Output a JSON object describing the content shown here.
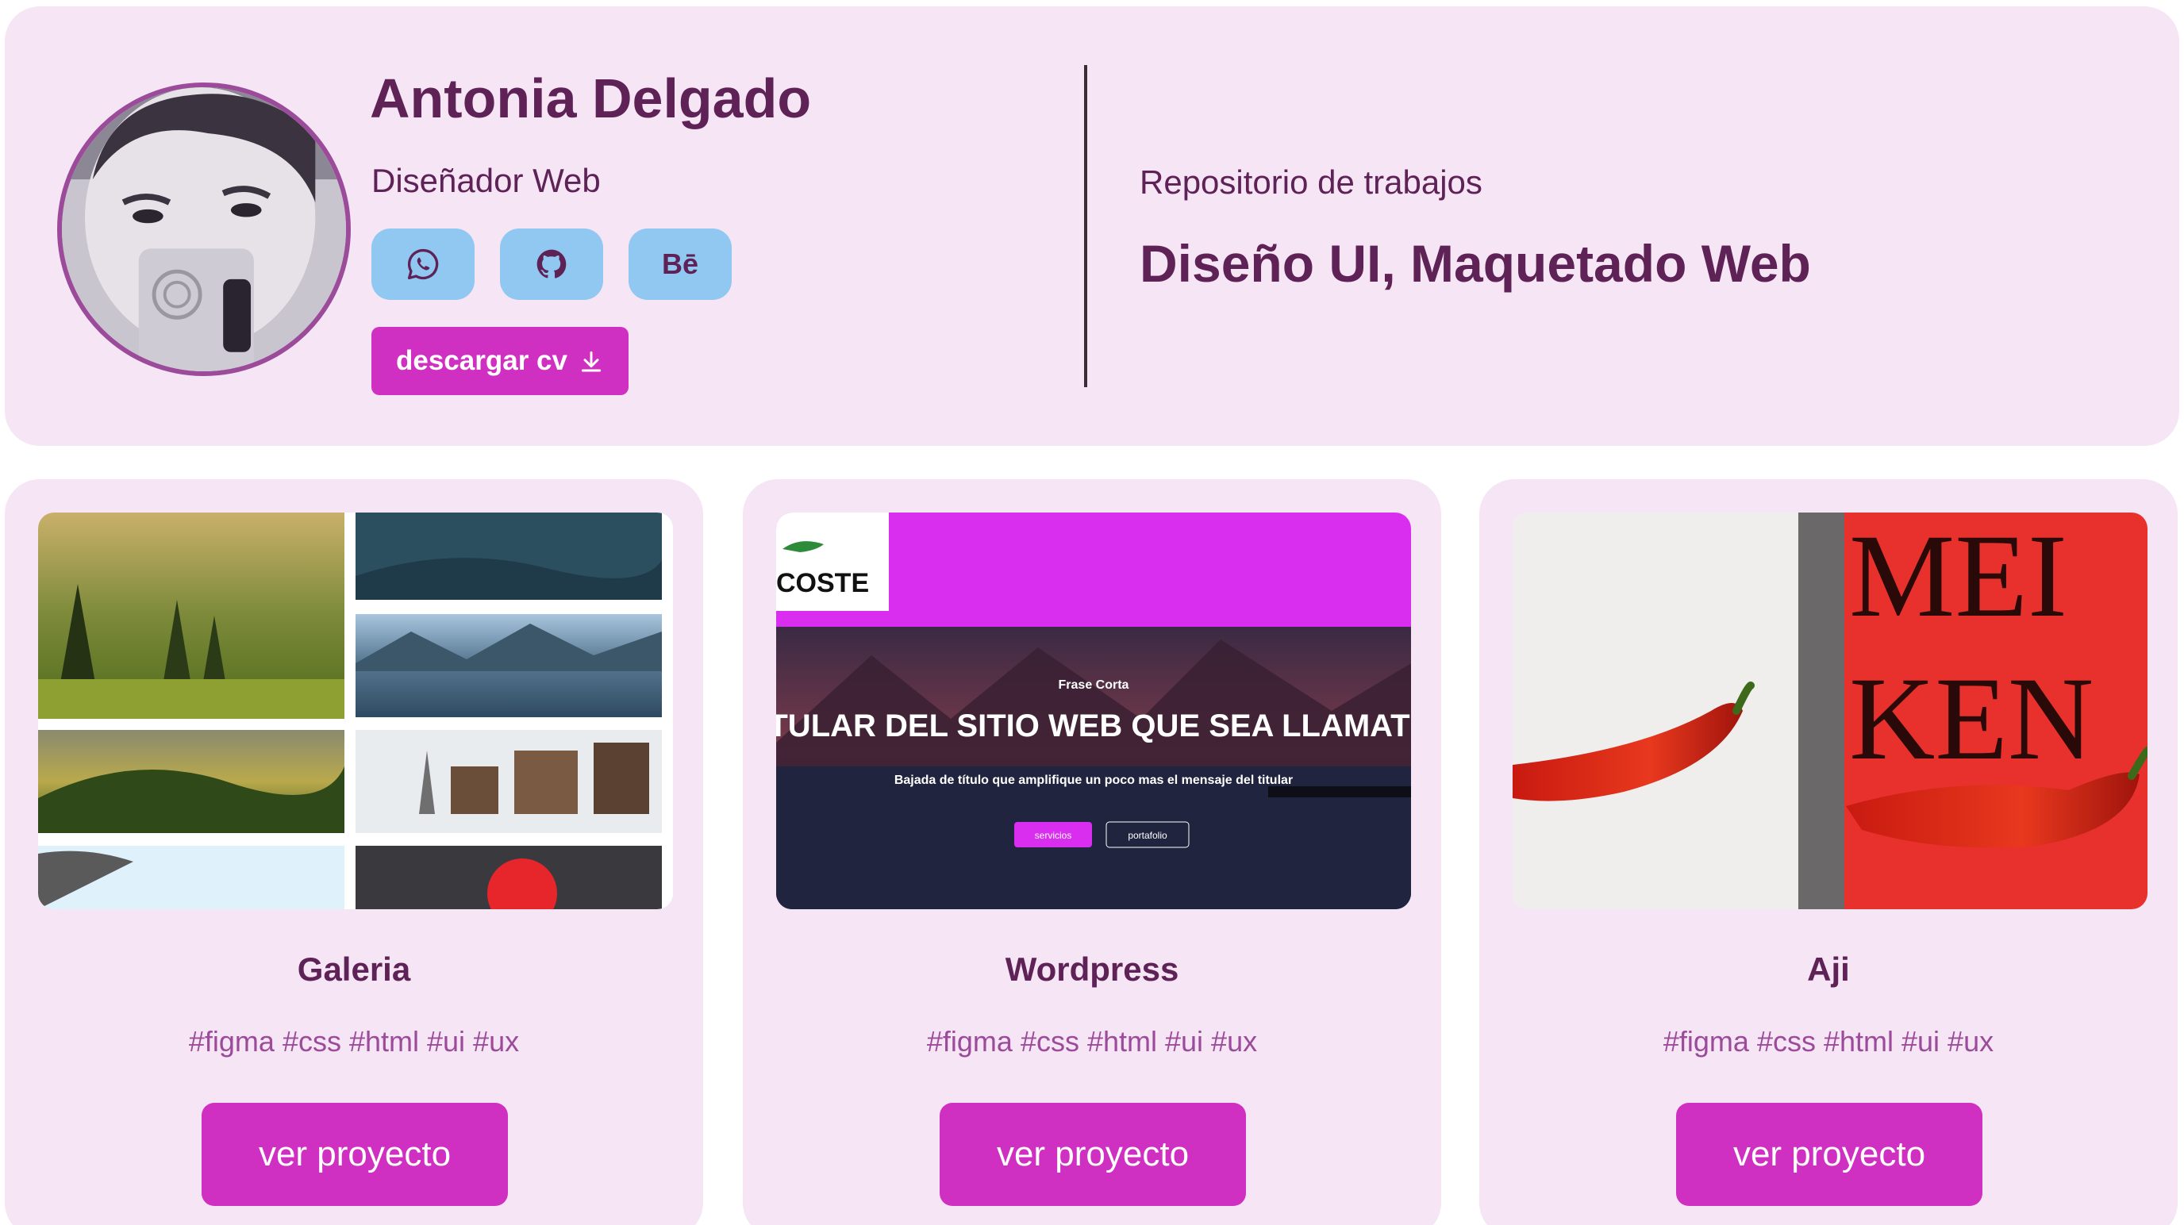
{
  "profile": {
    "name": "Antonia Delgado",
    "role": "Diseñador Web",
    "social": [
      {
        "icon": "whatsapp-icon"
      },
      {
        "icon": "github-icon"
      },
      {
        "icon": "behance-icon",
        "label": "Bē"
      }
    ],
    "cv_button": {
      "label": "descargar cv",
      "icon": "download-icon"
    }
  },
  "repository": {
    "label": "Repositorio de trabajos",
    "title": "Diseño UI, Maquetado Web"
  },
  "projects": [
    {
      "title": "Galeria",
      "tags": "#figma #css #html #ui #ux",
      "button": "ver proyecto"
    },
    {
      "title": "Wordpress",
      "tags": "#figma #css #html #ui #ux",
      "button": "ver proyecto",
      "preview": {
        "logo_text": "COSTE",
        "eyebrow": "Frase Corta",
        "headline": "TULAR DEL SITIO WEB QUE SEA LLAMATI",
        "subtitle": "Bajada de título que amplifique un poco mas el mensaje del titular",
        "btn_primary": "servicios",
        "btn_secondary": "portafolio"
      }
    },
    {
      "title": "Aji",
      "tags": "#figma #css #html #ui #ux",
      "button": "ver proyecto",
      "preview": {
        "poster_line1": "MEI",
        "poster_line2": "KEN"
      }
    }
  ],
  "colors": {
    "panel_bg": "#f6e5f5",
    "primary_text": "#5e2257",
    "accent": "#d030c2",
    "social_bg": "#90c8f2",
    "tag_text": "#9b4b9a"
  }
}
